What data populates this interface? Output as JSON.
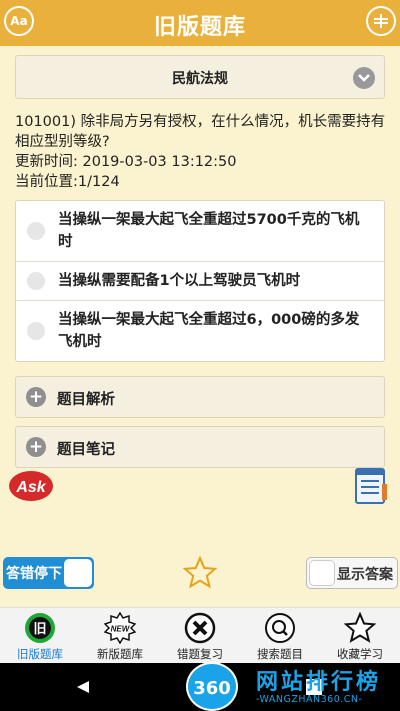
{
  "header": {
    "title": "旧版题库",
    "left_icon": "font-size-icon",
    "right_icon": "card-icon"
  },
  "category": {
    "selected": "民航法规"
  },
  "question": {
    "text": "101001) 除非局方另有授权，在什么情况，机长需要持有相应型别等级?",
    "updated": "更新时间: 2019-03-03 13:12:50",
    "position": "当前位置:1/124"
  },
  "options": [
    {
      "label": "当操纵一架最大起飞全重超过5700千克的飞机时"
    },
    {
      "label": "当操纵需要配备1个以上驾驶员飞机时"
    },
    {
      "label": "当操纵一架最大起飞全重超过6，000磅的多发飞机时"
    }
  ],
  "sections": {
    "analysis": "题目解析",
    "notes": "题目笔记"
  },
  "controls": {
    "stop_on_wrong": "答错停下",
    "show_answer": "显示答案"
  },
  "tabs": [
    {
      "label": "旧版题库",
      "icon": "old-bank-icon"
    },
    {
      "label": "新版题库",
      "icon": "new-badge-icon"
    },
    {
      "label": "错题复习",
      "icon": "wrong-x-icon"
    },
    {
      "label": "搜索题目",
      "icon": "search-icon"
    },
    {
      "label": "收藏学习",
      "icon": "star-icon"
    }
  ],
  "watermark": {
    "badge": "360",
    "cn": "网站排行榜",
    "en": "-WANGZHAN360.CN-"
  },
  "colors": {
    "header": "#e9b13b",
    "background": "#fbf3cf",
    "accent": "#1f8ed5",
    "active_tab": "#1a7bd1"
  }
}
